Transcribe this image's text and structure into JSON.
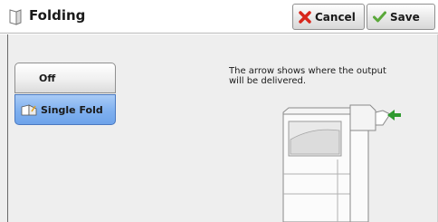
{
  "header": {
    "title": "Folding",
    "cancel_label": "Cancel",
    "save_label": "Save"
  },
  "options": [
    {
      "label": "Off",
      "selected": false
    },
    {
      "label": "Single Fold",
      "selected": true
    }
  ],
  "hint": "The arrow shows where the output will be delivered.",
  "colors": {
    "selected_option": "#7fb0ef",
    "arrow": "#2f9a2f",
    "cancel_icon": "#d8261b",
    "save_icon": "#5aa83a"
  },
  "icons": {
    "title": "folding-icon",
    "cancel": "red-x-icon",
    "save": "checkmark-icon",
    "single_fold": "single-fold-icon",
    "output_arrow": "green-arrow-icon"
  }
}
